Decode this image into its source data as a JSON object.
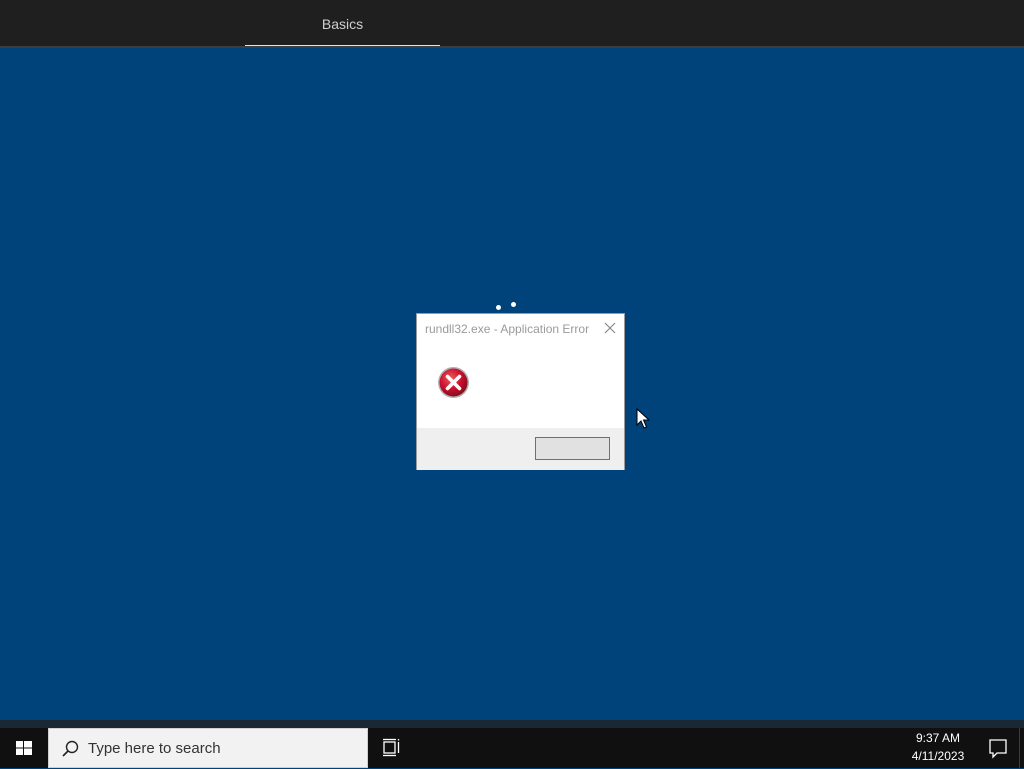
{
  "setup": {
    "tab_label": "Basics"
  },
  "dialog": {
    "title": "rundll32.exe - Application Error",
    "icon": "error-icon",
    "ok_label": ""
  },
  "taskbar": {
    "search_placeholder": "Type here to search",
    "time": "9:37 AM",
    "date": "4/11/2023"
  },
  "colors": {
    "desktop": "#00427a",
    "topbar": "#1f1f1f",
    "taskbar": "#101010",
    "error_red": "#c8102e"
  }
}
